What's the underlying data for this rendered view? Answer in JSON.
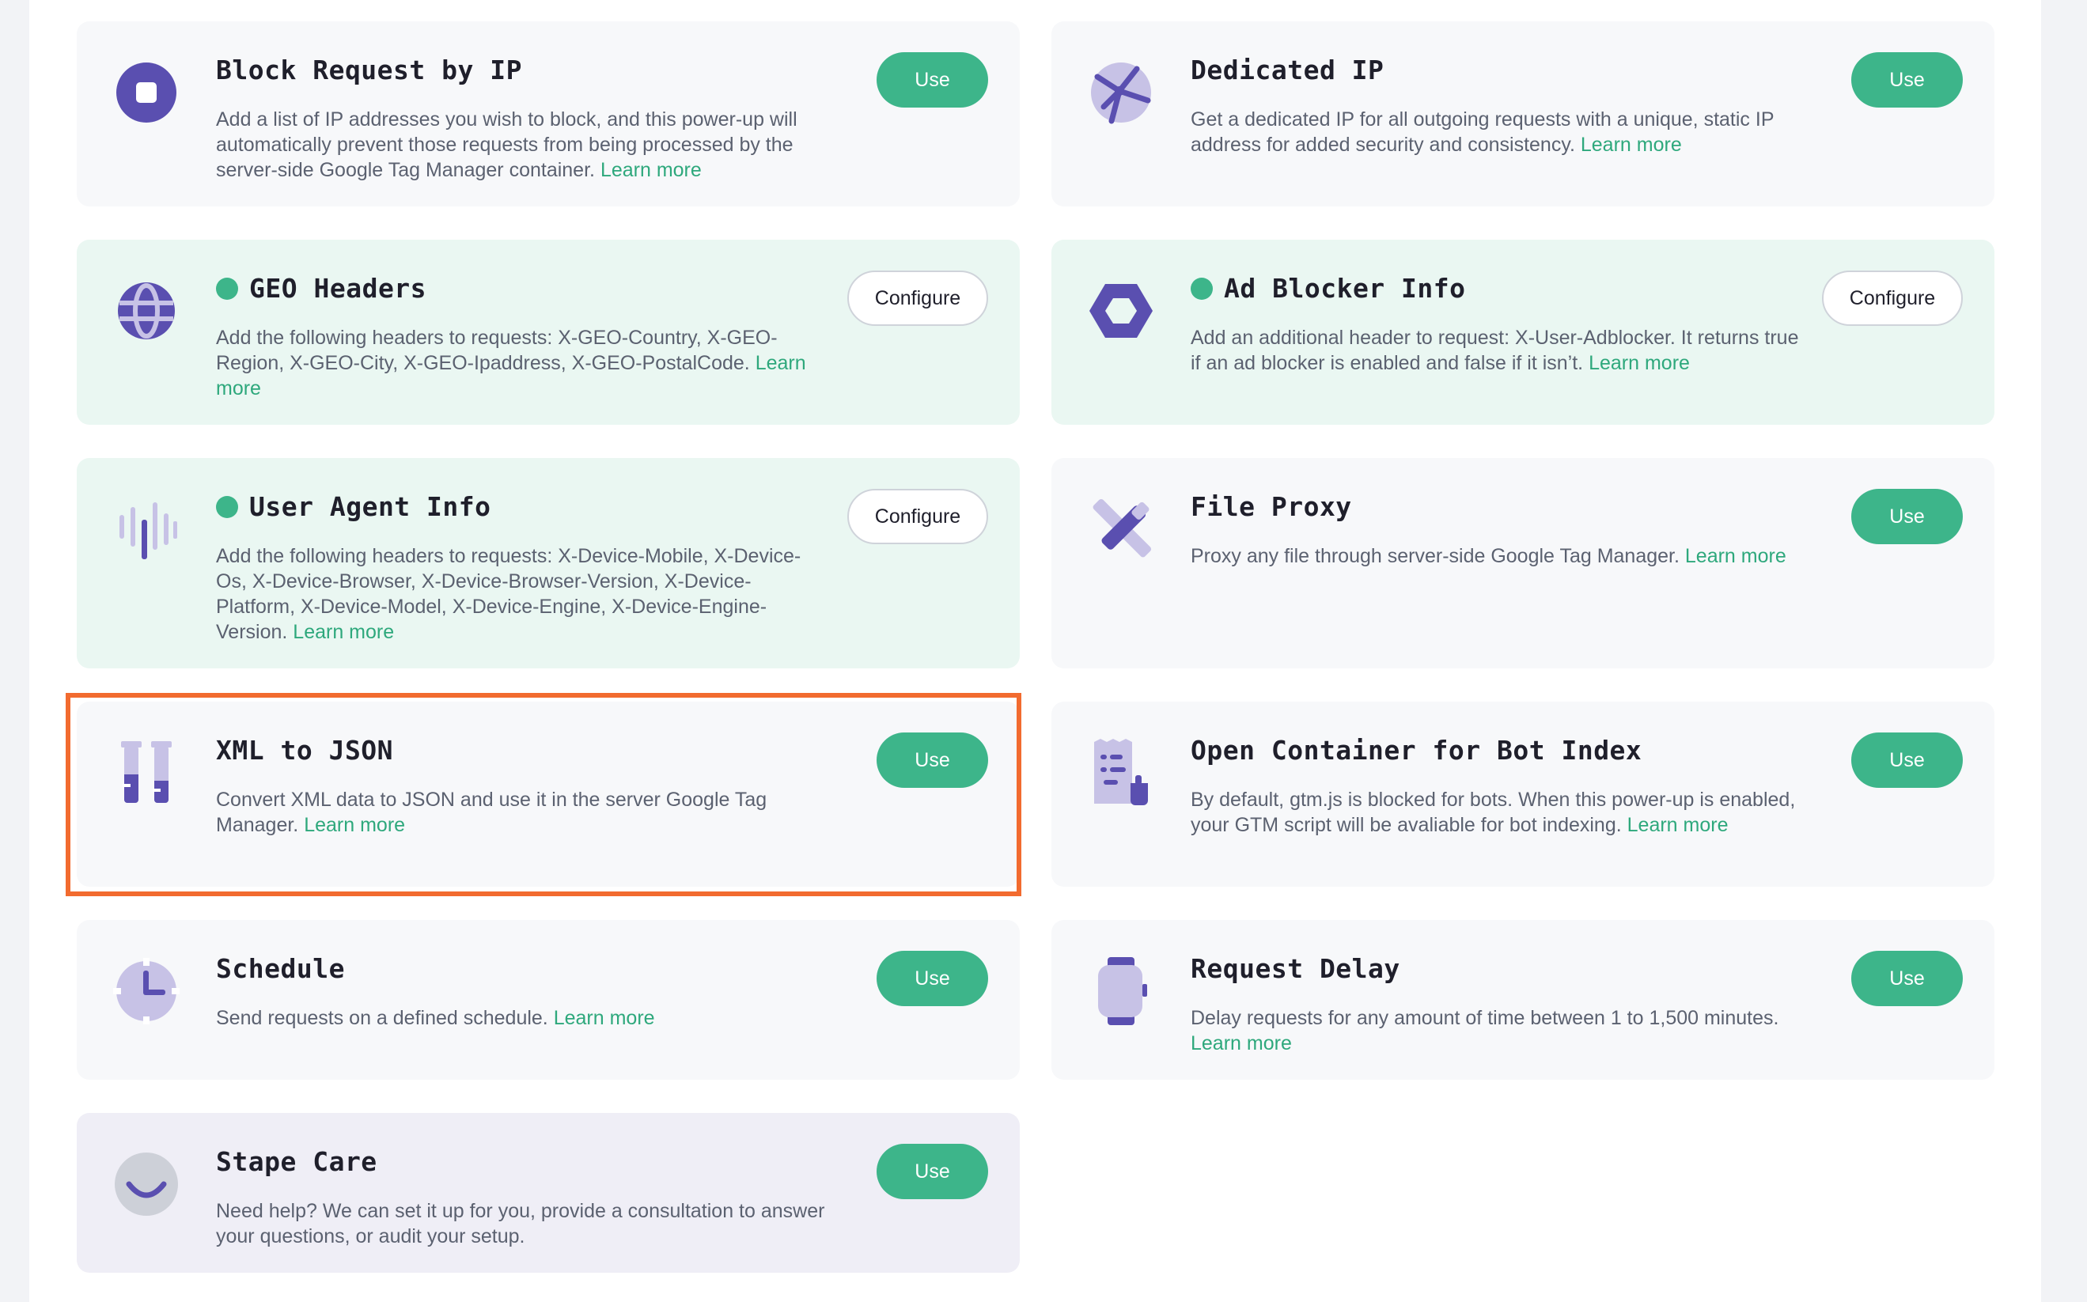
{
  "colors": {
    "accent_green": "#3db58a",
    "link_green": "#2ea87c",
    "icon_purple": "#5a4fb0",
    "icon_lavender": "#c7c2e6",
    "highlight_orange": "#f26b2f"
  },
  "cards": [
    {
      "icon": "block-icon",
      "title": "Block Request by IP",
      "active": false,
      "description": "Add a list of IP addresses you wish to block, and this power-up will automatically prevent those requests from being processed by the server-side Google Tag Manager container.",
      "learn_more": "Learn more",
      "button": "Use"
    },
    {
      "icon": "globe-network-icon",
      "title": "Dedicated IP",
      "active": false,
      "description": "Get a dedicated IP for all outgoing requests with a unique, static IP address for added security and consistency.",
      "learn_more": "Learn more",
      "button": "Use"
    },
    {
      "icon": "globe-icon",
      "title": "GEO Headers",
      "active": true,
      "description": "Add the following headers to requests: X-GEO-Country, X-GEO-Region, X-GEO-City, X-GEO-Ipaddress, X-GEO-PostalCode.",
      "learn_more": "Learn more",
      "button": "Configure"
    },
    {
      "icon": "hexagon-icon",
      "title": "Ad Blocker Info",
      "active": true,
      "description": "Add an additional header to request: X-User-Adblocker. It returns true if an ad blocker is enabled and false if it isn’t.",
      "learn_more": "Learn more",
      "button": "Configure"
    },
    {
      "icon": "soundwave-icon",
      "title": "User Agent Info",
      "active": true,
      "description": "Add the following headers to requests: X-Device-Mobile, X-Device-Os, X-Device-Browser, X-Device-Browser-Version, X-Device-Platform, X-Device-Model, X-Device-Engine, X-Device-Engine-Version.",
      "learn_more": "Learn more",
      "button": "Configure"
    },
    {
      "icon": "tools-icon",
      "title": "File Proxy",
      "active": false,
      "description": "Proxy any file through server-side Google Tag Manager.",
      "learn_more": "Learn more",
      "button": "Use"
    },
    {
      "icon": "test-tubes-icon",
      "title": "XML to JSON",
      "active": false,
      "description": "Convert XML data to JSON and use it in the server Google Tag Manager.",
      "learn_more": "Learn more",
      "button": "Use"
    },
    {
      "icon": "document-robot-icon",
      "title": "Open Container for Bot Index",
      "active": false,
      "description": "By default, gtm.js is blocked for bots. When this power-up is enabled, your GTM script will be avaliable for bot indexing.",
      "learn_more": "Learn more",
      "button": "Use"
    },
    {
      "icon": "clock-icon",
      "title": "Schedule",
      "active": false,
      "description": "Send requests on a defined schedule.",
      "learn_more": "Learn more",
      "button": "Use"
    },
    {
      "icon": "watch-icon",
      "title": "Request Delay",
      "active": false,
      "description": "Delay requests for any amount of time between 1 to 1,500 minutes.",
      "learn_more": "Learn more",
      "button": "Use"
    },
    {
      "icon": "smile-icon",
      "title": "Stape Care",
      "active": false,
      "description": "Need help? We can set it up for you, provide a consultation to answer your questions, or audit your setup.",
      "learn_more": "",
      "button": "Use"
    }
  ]
}
